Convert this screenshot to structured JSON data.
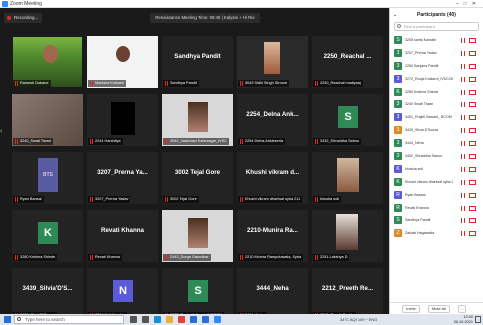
{
  "window": {
    "title": "Zoom Meeting"
  },
  "recording": {
    "label": "Recording..."
  },
  "meeting_banner": "Renaissance Meeting Time: 08:45 | Kalyani + Hi Rio",
  "tiles": [
    {
      "id": "t1",
      "video": "v-man",
      "nameplate": "Ramesh Dubane"
    },
    {
      "id": "t2",
      "video": "v-woman1",
      "nameplate": "Manisha Kulkarni"
    },
    {
      "id": "t3",
      "center": "Sandhya Pandit",
      "nameplate": "Sandhya Pandit"
    },
    {
      "id": "t4",
      "video": "v-poster",
      "nameplate": "3043 Sidhi Singh Stroom"
    },
    {
      "id": "t5",
      "center": "2250_Reachal ...",
      "nameplate": "2250_Reachal madlyaaj"
    },
    {
      "id": "t6",
      "video": "v-hands",
      "nameplate": "3240_Swati Tiwari"
    },
    {
      "id": "t7",
      "video": "v-black",
      "nameplate": "2244 Harshitya"
    },
    {
      "id": "t8",
      "video": "v-girl2",
      "nameplate": "3052_Vaishnavi Kshirsagar_IVSC"
    },
    {
      "id": "t9",
      "center": "2254_Delna Ank...",
      "nameplate": "2254 Delna Ankleseria"
    },
    {
      "id": "t10",
      "avatar": "S",
      "avatar_color": "#2e8b57",
      "nameplate": "3432_Shraddha Sahoo"
    },
    {
      "id": "t11",
      "video": "v-bts",
      "nameplate": "Ryan Bansal"
    },
    {
      "id": "t12",
      "center": "3207_Prerna Ya...",
      "nameplate": "3207_Prerna Yadav"
    },
    {
      "id": "t13",
      "center": "3002 Tejal Gore",
      "nameplate": "3002 Tejal Gore"
    },
    {
      "id": "t14",
      "center": "Khushi vikram d...",
      "nameplate": "Khushi vikram dhariwal syba 211"
    },
    {
      "id": "t15",
      "video": "v-girl3",
      "nameplate": "khusha soli"
    },
    {
      "id": "t16",
      "avatar": "K",
      "avatar_color": "#2e8b57",
      "nameplate": "3280 Krishna Shinde"
    },
    {
      "id": "t17",
      "center": "Revati Khanna",
      "nameplate": "Revati Khanna"
    },
    {
      "id": "t18",
      "video": "v-girl2",
      "nameplate": "2443_Durga Gaundkar"
    },
    {
      "id": "t19",
      "center": "2210-Munira Ra...",
      "nameplate": "2210 Munira Ramputawala, Syba"
    },
    {
      "id": "t20",
      "video": "v-girl4",
      "nameplate": "2251 Lakshya D"
    },
    {
      "id": "t21",
      "center": "3439_Silvia'D'S...",
      "nameplate": "3439_Silvia'D'Souza"
    },
    {
      "id": "t22",
      "avatar": "N",
      "avatar_color": "#5b5bd6",
      "nameplate": "3204 Nidi Nagdev"
    },
    {
      "id": "t23",
      "avatar": "S",
      "avatar_color": "#2e8b57",
      "nameplate": "3272_Rooja Kulkarni_IVSCOM"
    },
    {
      "id": "t24",
      "center": "3444_Neha",
      "nameplate": "3444_Neha"
    },
    {
      "id": "t25",
      "center": "2212_Preeth Re...",
      "nameplate": "2212_Preeth Reddy"
    }
  ],
  "panel": {
    "title": "Participants (40)",
    "search_placeholder": "Find a participant",
    "participants": [
      {
        "initial": "S",
        "name": "3205 sarita Kamath",
        "color": "#2e8b57"
      },
      {
        "initial": "3",
        "name": "3207_Prerna Yadav",
        "color": "#2e8b57"
      },
      {
        "initial": "3",
        "name": "2250 Sanjana Pandit",
        "color": "#2e8b57"
      },
      {
        "initial": "3",
        "name": "3272_Rooja Kulkarni_IVSCOM",
        "color": "#5b5bd6"
      },
      {
        "initial": "K",
        "name": "3280 Krishna Shinde",
        "color": "#2e8b57"
      },
      {
        "initial": "3",
        "name": "3240 Swati Tiwari",
        "color": "#2e8b57"
      },
      {
        "initial": "3",
        "name": "3451_Prajkti Sawant_ BCOM",
        "color": "#5b5bd6"
      },
      {
        "initial": "3",
        "name": "3439_Silvia D'Souza",
        "color": "#e0892a"
      },
      {
        "initial": "3",
        "name": "3444_Neha",
        "color": "#2e8b57"
      },
      {
        "initial": "3",
        "name": "3452_Shraddha Sahoo",
        "color": "#2e8b57"
      },
      {
        "initial": "K",
        "name": "khusha soli",
        "color": "#5b5bd6"
      },
      {
        "initial": "K",
        "name": "Khushi vikram dhariwal syba 21",
        "color": "#2e8b57"
      },
      {
        "initial": "R",
        "name": "Ryan Bansal",
        "color": "#5b5bd6"
      },
      {
        "initial": "R",
        "name": "Revati Khanna",
        "color": "#2e8b57"
      },
      {
        "initial": "S",
        "name": "Sandhya Pandit",
        "color": "#2e8b57"
      },
      {
        "initial": "Z",
        "name": "Zainab Hagarwala",
        "color": "#e0892a"
      }
    ],
    "invite_label": "Invite",
    "mute_all_label": "Mute All"
  },
  "taskbar": {
    "search_placeholder": "Type here to search",
    "tray_text": "34°C  AQI 109  ^  ENG",
    "time": "10:00",
    "date": "26-10-2021",
    "apps": [
      {
        "name": "cortana-icon",
        "color": "#555555"
      },
      {
        "name": "task-view-icon",
        "color": "#555555"
      },
      {
        "name": "edge-icon",
        "color": "#1a8fd6"
      },
      {
        "name": "explorer-icon",
        "color": "#e8b23a"
      },
      {
        "name": "chrome-icon",
        "color": "#db4437"
      },
      {
        "name": "store-icon",
        "color": "#2b6fd6"
      },
      {
        "name": "mail-icon",
        "color": "#2b6fd6"
      },
      {
        "name": "zoom-icon",
        "color": "#2d8cff"
      }
    ]
  }
}
